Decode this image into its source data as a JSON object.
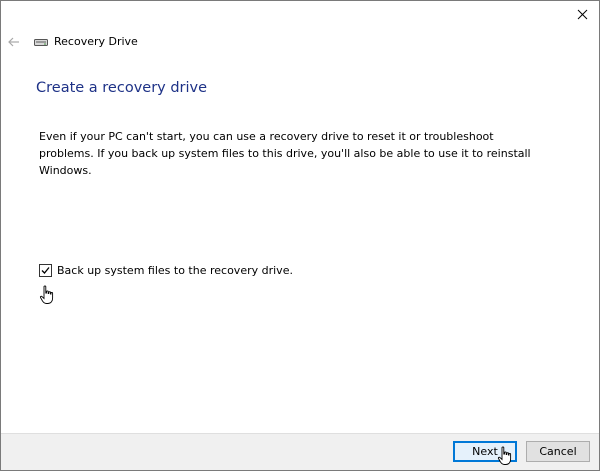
{
  "window": {
    "app_title": "Recovery Drive",
    "close_glyph": "✕",
    "back_glyph": "←"
  },
  "page": {
    "title": "Create a recovery drive",
    "description": "Even if your PC can't start, you can use a recovery drive to reset it or troubleshoot problems. If you back up system files to this drive, you'll also be able to use it to reinstall Windows."
  },
  "option": {
    "label": "Back up system files to the recovery drive.",
    "checked": true
  },
  "buttons": {
    "next": "Next",
    "cancel": "Cancel"
  },
  "icons": {
    "app": "drive-icon",
    "cursor": "hand-cursor-icon"
  },
  "colors": {
    "title": "#1e3287",
    "accent": "#0078d7",
    "footer_bg": "#f0f0f0"
  }
}
